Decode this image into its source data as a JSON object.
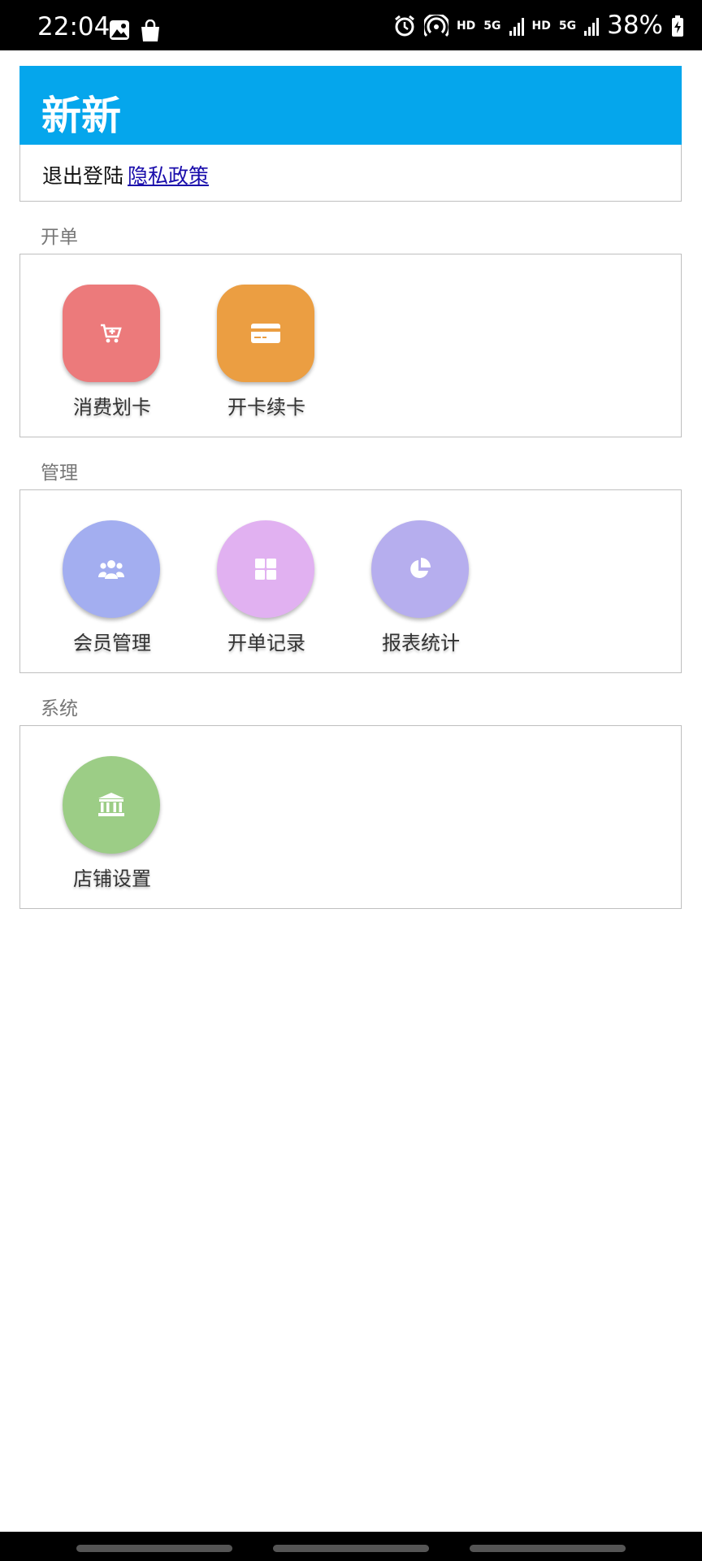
{
  "status_bar": {
    "time": "22:04",
    "hd1": "HD",
    "net1": "5G",
    "hd2": "HD",
    "net2": "5G",
    "battery": "38%",
    "icons": [
      "image-icon",
      "shopping-bag-icon",
      "alarm-icon",
      "hotspot-icon",
      "signal-icon",
      "battery-charging-icon"
    ]
  },
  "header": {
    "title": "新新",
    "accent_color": "#05a6ec"
  },
  "links": {
    "logout": "退出登陆",
    "privacy": "隐私政策"
  },
  "sections": [
    {
      "label": "开单",
      "items": [
        {
          "label": "消费划卡",
          "icon": "cart-plus-icon",
          "color": "#ec7a7b"
        },
        {
          "label": "开卡续卡",
          "icon": "credit-card-icon",
          "color": "#eb9e42"
        }
      ]
    },
    {
      "label": "管理",
      "items": [
        {
          "label": "会员管理",
          "icon": "users-icon",
          "color": "#a3aef0"
        },
        {
          "label": "开单记录",
          "icon": "grid-icon",
          "color": "#e1b1f1"
        },
        {
          "label": "报表统计",
          "icon": "pie-chart-icon",
          "color": "#b6aeee"
        }
      ]
    },
    {
      "label": "系统",
      "items": [
        {
          "label": "店铺设置",
          "icon": "bank-icon",
          "color": "#9ccd86"
        }
      ]
    }
  ]
}
